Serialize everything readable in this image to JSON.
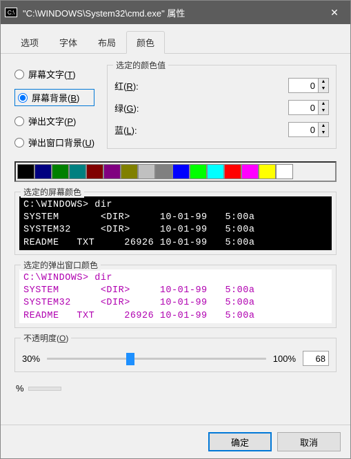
{
  "titlebar": {
    "icon_text": "C:\\",
    "title": "\"C:\\WINDOWS\\System32\\cmd.exe\" 属性",
    "close_label": "✕"
  },
  "tabs": {
    "items": [
      "选项",
      "字体",
      "布局",
      "颜色"
    ],
    "active_index": 3
  },
  "targets": {
    "items": [
      {
        "label_pre": "屏幕文字(",
        "accel": "T",
        "label_post": ")",
        "selected": false
      },
      {
        "label_pre": "屏幕背景(",
        "accel": "B",
        "label_post": ")",
        "selected": true
      },
      {
        "label_pre": "弹出文字(",
        "accel": "P",
        "label_post": ")",
        "selected": false
      },
      {
        "label_pre": "弹出窗口背景(",
        "accel": "U",
        "label_post": ")",
        "selected": false
      }
    ]
  },
  "color_values": {
    "legend": "选定的颜色值",
    "r_label_pre": "红(",
    "r_accel": "R",
    "r_label_post": "):",
    "r_value": "0",
    "g_label_pre": "绿(",
    "g_accel": "G",
    "g_label_post": "):",
    "g_value": "0",
    "b_label_pre": "蓝(",
    "b_accel": "L",
    "b_label_post": "):",
    "b_value": "0"
  },
  "palette": {
    "colors": [
      "#000000",
      "#000080",
      "#008000",
      "#008080",
      "#800000",
      "#800080",
      "#808000",
      "#c0c0c0",
      "#808080",
      "#0000ff",
      "#00ff00",
      "#00ffff",
      "#ff0000",
      "#ff00ff",
      "#ffff00",
      "#ffffff"
    ],
    "selected_index": 0
  },
  "preview_screen": {
    "legend": "选定的屏幕颜色",
    "text": "C:\\WINDOWS> dir\nSYSTEM       <DIR>     10-01-99   5:00a\nSYSTEM32     <DIR>     10-01-99   5:00a\nREADME   TXT     26926 10-01-99   5:00a"
  },
  "preview_popup": {
    "legend": "选定的弹出窗口颜色",
    "text": "C:\\WINDOWS> dir\nSYSTEM       <DIR>     10-01-99   5:00a\nSYSTEM32     <DIR>     10-01-99   5:00a\nREADME   TXT     26926 10-01-99   5:00a"
  },
  "opacity": {
    "legend_pre": "不透明度(",
    "legend_accel": "O",
    "legend_post": ")",
    "min_label": "30%",
    "max_label": "100%",
    "value": "68",
    "percent_pos": 38
  },
  "extra_percent": "%",
  "buttons": {
    "ok": "确定",
    "cancel": "取消"
  }
}
